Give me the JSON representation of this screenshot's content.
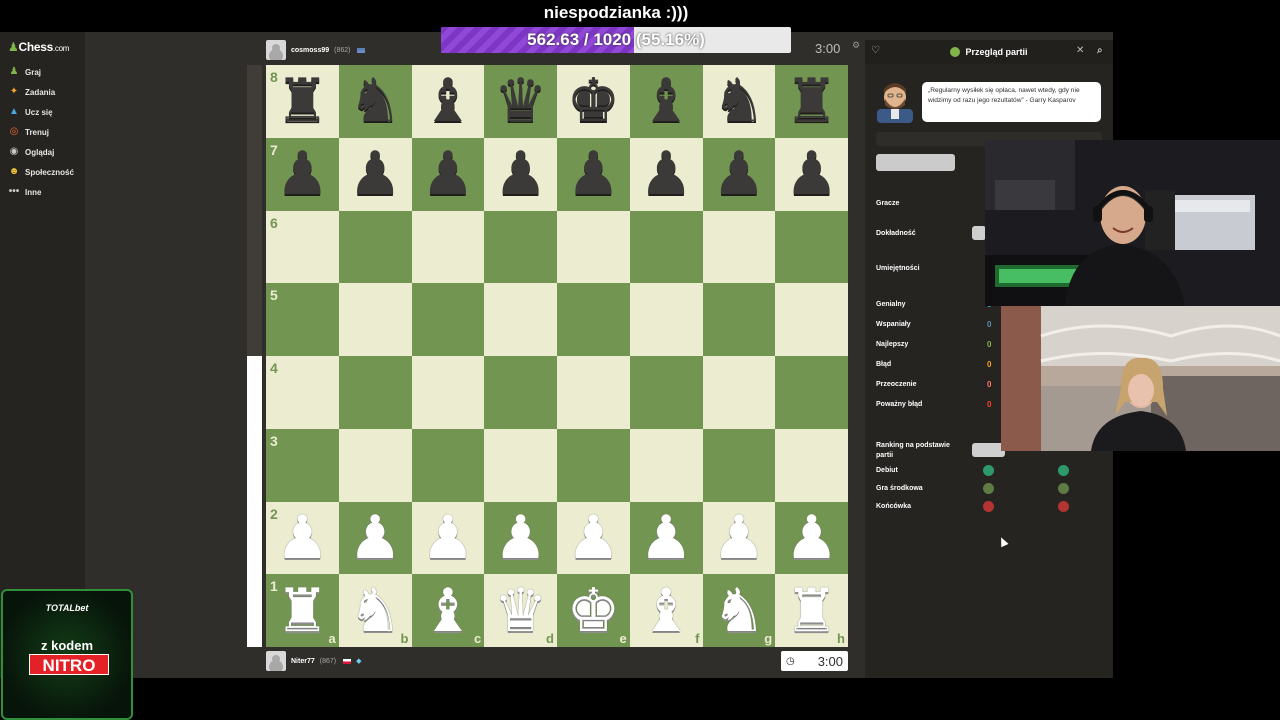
{
  "stream": {
    "title": "niespodzianka :)))",
    "goal_text": "562.63 / 1020 (55.16%)",
    "goal_fraction": 0.5516
  },
  "sidebar": {
    "logo_text": "Chess",
    "logo_suffix": ".com",
    "items": [
      {
        "label": "Graj",
        "icon": "play-pawn-icon",
        "color": "#81b64c"
      },
      {
        "label": "Zadania",
        "icon": "puzzle-icon",
        "color": "#f7a41e"
      },
      {
        "label": "Ucz się",
        "icon": "learn-cap-icon",
        "color": "#46a6e0"
      },
      {
        "label": "Trenuj",
        "icon": "train-target-icon",
        "color": "#ef6a3a"
      },
      {
        "label": "Oglądaj",
        "icon": "watch-binoculars-icon",
        "color": "#c8c8c8"
      },
      {
        "label": "Społeczność",
        "icon": "community-icon",
        "color": "#efbf3a"
      },
      {
        "label": "Inne",
        "icon": "more-dots-icon",
        "color": "#c8c8c8"
      }
    ]
  },
  "game": {
    "top_player": {
      "name": "cosmoss99",
      "rating": "(862)"
    },
    "bottom_player": {
      "name": "Niter77",
      "rating": "(867)"
    },
    "top_clock": "3:00",
    "bottom_clock": "3:00",
    "eval_white_fraction": 0.5
  },
  "board": {
    "light": "#ebecd0",
    "dark": "#739552",
    "ranks": [
      "8",
      "7",
      "6",
      "5",
      "4",
      "3",
      "2",
      "1"
    ],
    "files": [
      "a",
      "b",
      "c",
      "d",
      "e",
      "f",
      "g",
      "h"
    ],
    "position": [
      [
        "r",
        "n",
        "b",
        "q",
        "k",
        "b",
        "n",
        "r"
      ],
      [
        "p",
        "p",
        "p",
        "p",
        "p",
        "p",
        "p",
        "p"
      ],
      [
        "",
        "",
        "",
        "",
        "",
        "",
        "",
        ""
      ],
      [
        "",
        "",
        "",
        "",
        "",
        "",
        "",
        ""
      ],
      [
        "",
        "",
        "",
        "",
        "",
        "",
        "",
        ""
      ],
      [
        "",
        "",
        "",
        "",
        "",
        "",
        "",
        ""
      ],
      [
        "P",
        "P",
        "P",
        "P",
        "P",
        "P",
        "P",
        "P"
      ],
      [
        "R",
        "N",
        "B",
        "Q",
        "K",
        "B",
        "N",
        "R"
      ]
    ]
  },
  "review": {
    "title": "Przegląd partii",
    "quote": "„Regularny wysiłek się opłaca, nawet wtedy, gdy nie widzimy od razu jego rezultatów” - Garry Kasparov",
    "labels": {
      "players": "Gracze",
      "accuracy": "Dokładność",
      "skills": "Umiejętności",
      "ranking": "Ranking na podstawie partii",
      "phase_opening": "Debiut",
      "phase_middle": "Gra środkowa",
      "phase_end": "Końcówka"
    },
    "classifications": [
      {
        "label": "Genialny",
        "count": "0",
        "color": "#26c2a3"
      },
      {
        "label": "Wspaniały",
        "count": "0",
        "color": "#5c8bb0"
      },
      {
        "label": "Najlepszy",
        "count": "0",
        "color": "#81b64c"
      },
      {
        "label": "Błąd",
        "count": "0",
        "color": "#f7a41e"
      },
      {
        "label": "Przeoczenie",
        "count": "0",
        "color": "#ff7769"
      },
      {
        "label": "Poważny błąd",
        "count": "0",
        "color": "#fa412d"
      }
    ],
    "phase_colors": [
      "#2d9a6c",
      "#5e7a45",
      "#b33430"
    ]
  },
  "sponsor": {
    "brand": "TOTALbet",
    "code_line": "z kodem",
    "code": "NITRO"
  }
}
